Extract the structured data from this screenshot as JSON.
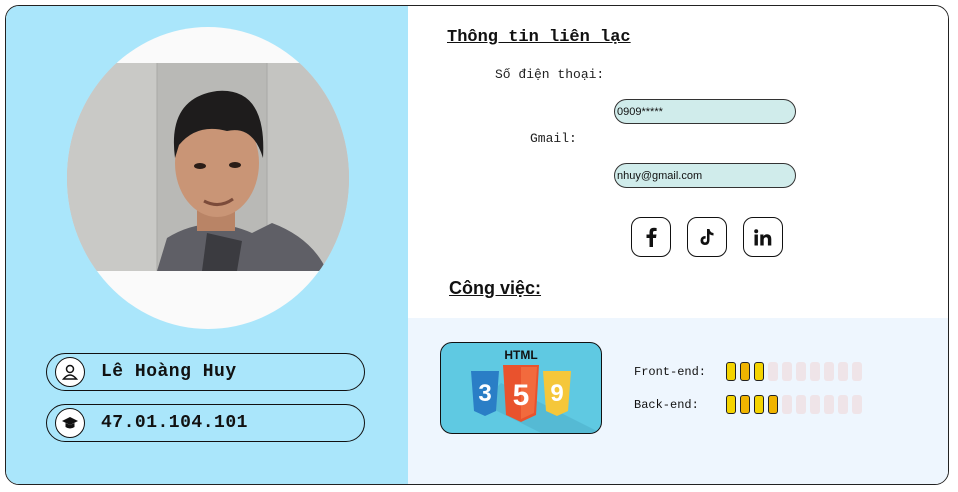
{
  "profile": {
    "name": "Lê Hoàng Huy",
    "student_id": "47.01.104.101"
  },
  "contact": {
    "heading": "Thông tin liên lạc",
    "phone_label": "Số điện thoại:",
    "phone_value": "0909*****",
    "gmail_label": "Gmail:",
    "gmail_value": "nhuy@gmail.com"
  },
  "social": [
    "facebook-icon",
    "tiktok-icon",
    "linkedin-icon"
  ],
  "job": {
    "heading": "Công việc:",
    "logo_text": "HTML",
    "skills": [
      {
        "label": "Front-end:",
        "level": 3,
        "max": 10
      },
      {
        "label": "Back-end:",
        "level": 4,
        "max": 10
      }
    ]
  },
  "colors": {
    "left_panel": "#aae6fb",
    "skill_fill": "#f5d400",
    "skill_fill_dark": "#f0b400",
    "skill_empty": "#efe4e8"
  }
}
